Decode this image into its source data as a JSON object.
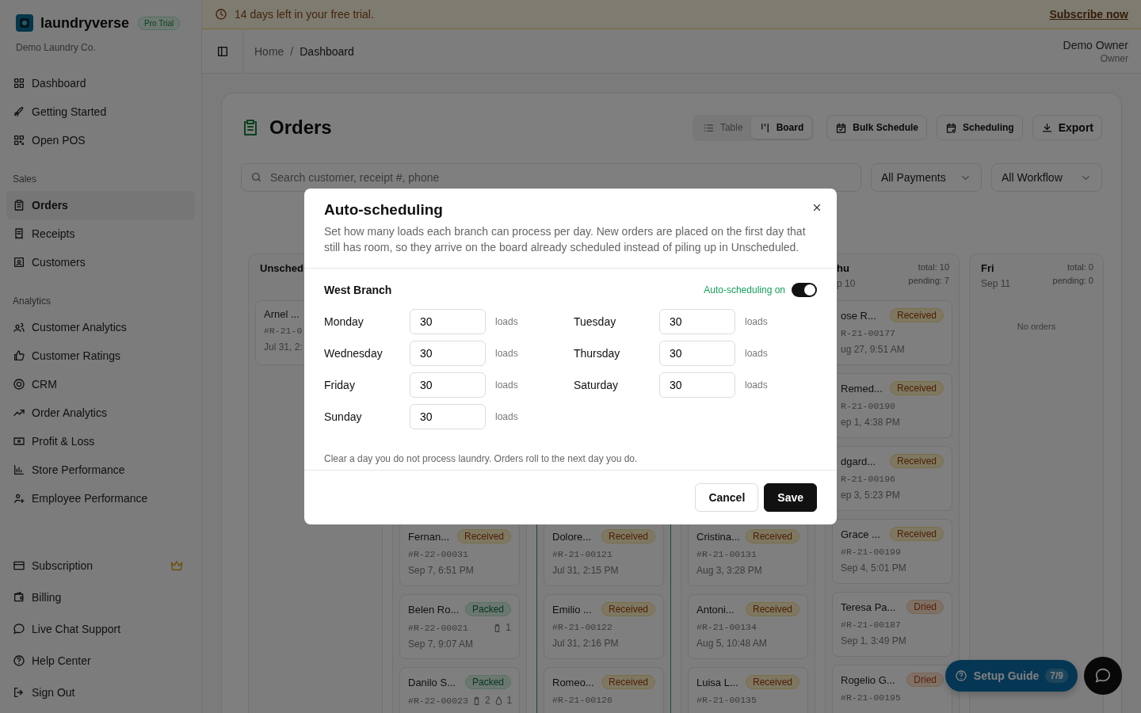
{
  "sidebar": {
    "brand": "laundryverse",
    "plan_badge": "Pro Trial",
    "company": "Demo Laundry Co.",
    "sections": [
      {
        "items": [
          {
            "label": "Dashboard",
            "selected": false
          },
          {
            "label": "Getting Started",
            "selected": false
          },
          {
            "label": "Open POS",
            "selected": false
          }
        ]
      },
      {
        "heading": "Sales",
        "items": [
          {
            "label": "Orders",
            "selected": true
          },
          {
            "label": "Receipts",
            "selected": false
          },
          {
            "label": "Customers",
            "selected": false
          }
        ]
      },
      {
        "heading": "Analytics",
        "items": [
          {
            "label": "Customer Analytics",
            "selected": false
          },
          {
            "label": "Customer Ratings",
            "selected": false
          },
          {
            "label": "CRM",
            "selected": false
          },
          {
            "label": "Order Analytics",
            "selected": false
          },
          {
            "label": "Profit & Loss",
            "selected": false
          },
          {
            "label": "Store Performance",
            "selected": false
          },
          {
            "label": "Employee Performance",
            "selected": false
          }
        ]
      },
      {
        "items": [
          {
            "label": "Subscription",
            "selected": false
          },
          {
            "label": "Billing",
            "selected": false
          },
          {
            "label": "Live Chat Support",
            "selected": false
          },
          {
            "label": "Help Center",
            "selected": false
          },
          {
            "label": "Sign Out",
            "selected": false
          }
        ]
      }
    ]
  },
  "trial_banner": {
    "text": "14 days left in your free trial.",
    "link": "Subscribe now"
  },
  "header": {
    "breadcrumb": [
      "Home",
      "Dashboard"
    ],
    "breadcrumb_separator": "/",
    "user_name": "Demo Owner",
    "user_role": "Owner"
  },
  "page": {
    "title": "Orders",
    "view_toggle": [
      {
        "label": "Table",
        "selected": false
      },
      {
        "label": "Board",
        "selected": true
      }
    ],
    "actions": [
      "Bulk Schedule",
      "Scheduling",
      "Export"
    ],
    "search": {
      "placeholder": "Search customer, receipt #, phone"
    },
    "filters": [
      "All Payments",
      "All Workflow"
    ]
  },
  "board": {
    "columns": [
      {
        "title": "Unsched",
        "today": false,
        "cards": [
          {
            "name": "Arnel ...",
            "receipt": "#R-21-0",
            "date": "Jul 31, 2:"
          }
        ]
      },
      {
        "today": false,
        "cards": [
          {
            "name": "Fernan...",
            "status": {
              "label": "Received",
              "kind": "received"
            },
            "receipt": "#R-22-00031",
            "date": "Sep 7, 6:51 PM"
          },
          {
            "name": "Belen Ro...",
            "status": {
              "label": "Packed",
              "kind": "packed"
            },
            "receipt": "#R-22-00021",
            "counts": [
              {
                "kind": "bag",
                "value": "1"
              }
            ],
            "date": "Sep 7, 9:07 AM"
          },
          {
            "name": "Danilo S...",
            "status": {
              "label": "Packed",
              "kind": "packed"
            },
            "receipt": "#R-22-00023",
            "counts": [
              {
                "kind": "bag",
                "value": "2"
              },
              {
                "kind": "drop",
                "value": "1"
              }
            ]
          }
        ]
      },
      {
        "today": true,
        "cards": [
          {
            "name": "Dolore...",
            "status": {
              "label": "Received",
              "kind": "received"
            },
            "receipt": "#R-21-00121",
            "date": "Jul 31, 2:15 PM"
          },
          {
            "name": "Emilio ...",
            "status": {
              "label": "Received",
              "kind": "received"
            },
            "receipt": "#R-21-00122",
            "date": "Jul 31, 2:16 PM"
          },
          {
            "name": "Romeo...",
            "status": {
              "label": "Received",
              "kind": "received"
            },
            "receipt": "#R-21-00126"
          }
        ]
      },
      {
        "today": false,
        "cards": [
          {
            "name": "Cristina...",
            "status": {
              "label": "Received",
              "kind": "received"
            },
            "receipt": "#R-21-00131",
            "date": "Aug 3, 3:28 PM"
          },
          {
            "name": "Antoni...",
            "status": {
              "label": "Received",
              "kind": "received"
            },
            "receipt": "#R-21-00134",
            "date": "Aug 5, 10:48 AM"
          },
          {
            "name": "Luisa L...",
            "status": {
              "label": "Received",
              "kind": "received"
            },
            "receipt": "#R-21-00135"
          }
        ]
      },
      {
        "title": "hu",
        "date": "p 10",
        "total": "total: 10",
        "pending": "pending: 7",
        "today": false,
        "cards": [
          {
            "name": "ose R...",
            "status": {
              "label": "Received",
              "kind": "received"
            },
            "receipt": "R-21-00177",
            "date": "ug 27, 9:51 AM"
          },
          {
            "name": "Remed...",
            "status": {
              "label": "Received",
              "kind": "received"
            },
            "receipt": "R-21-00190",
            "date": "ep 1, 4:38 PM"
          },
          {
            "name": "dgard...",
            "status": {
              "label": "Received",
              "kind": "received"
            },
            "receipt": "R-21-00196",
            "date": "ep 3, 5:23 PM"
          },
          {
            "name": "Grace ...",
            "status": {
              "label": "Received",
              "kind": "received"
            },
            "receipt": "#R-21-00199",
            "date": "Sep 4, 5:01 PM"
          },
          {
            "name": "Teresa Pa...",
            "status": {
              "label": "Dried",
              "kind": "dried"
            },
            "receipt": "#R-21-00187",
            "date": "Sep 1, 3:49 PM"
          },
          {
            "name": "Rogelio G...",
            "status": {
              "label": "Dried",
              "kind": "dried"
            },
            "receipt": "#R-21-00195"
          }
        ]
      },
      {
        "title": "Fri",
        "date": "Sep 11",
        "total": "total: 0",
        "pending": "pending: 0",
        "today": false,
        "empty": "No orders"
      }
    ]
  },
  "setup_guide": {
    "label": "Setup Guide",
    "progress": "7/9"
  },
  "dialog": {
    "title": "Auto-scheduling",
    "description": "Set how many loads each branch can process per day. New orders are placed on the first day that still has room, so they arrive on the board already scheduled instead of piling up in Unscheduled.",
    "branch": "West Branch",
    "auto_label": "Auto-scheduling on",
    "auto_on": true,
    "days": [
      {
        "day": "Monday",
        "value": "30",
        "unit": "loads"
      },
      {
        "day": "Tuesday",
        "value": "30",
        "unit": "loads"
      },
      {
        "day": "Wednesday",
        "value": "30",
        "unit": "loads"
      },
      {
        "day": "Thursday",
        "value": "30",
        "unit": "loads"
      },
      {
        "day": "Friday",
        "value": "30",
        "unit": "loads"
      },
      {
        "day": "Saturday",
        "value": "30",
        "unit": "loads"
      },
      {
        "day": "Sunday",
        "value": "30",
        "unit": "loads"
      }
    ],
    "note": "Clear a day you do not process laundry. Orders roll to the next day you do.",
    "buttons": [
      "Cancel",
      "Save"
    ]
  }
}
